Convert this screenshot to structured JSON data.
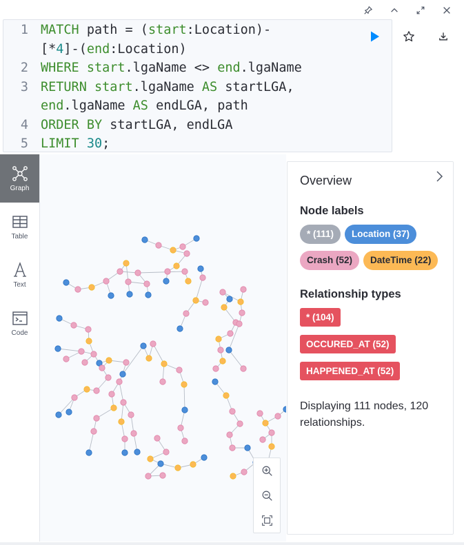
{
  "editor": {
    "line_numbers": [
      "1",
      "",
      "2",
      "3",
      "",
      "4",
      "5"
    ],
    "lines": [
      [
        {
          "t": "kw",
          "v": "MATCH"
        },
        {
          "t": "p",
          "v": " path = ("
        },
        {
          "t": "kw",
          "v": "start"
        },
        {
          "t": "p",
          "v": ":Location)-"
        }
      ],
      [
        {
          "t": "p",
          "v": "["
        },
        {
          "t": "p",
          "v": "*"
        },
        {
          "t": "num",
          "v": "4"
        },
        {
          "t": "p",
          "v": "]-("
        },
        {
          "t": "kw",
          "v": "end"
        },
        {
          "t": "p",
          "v": ":Location)"
        }
      ],
      [
        {
          "t": "kw",
          "v": "WHERE"
        },
        {
          "t": "p",
          "v": " "
        },
        {
          "t": "kw",
          "v": "start"
        },
        {
          "t": "p",
          "v": ".lgaName <> "
        },
        {
          "t": "kw",
          "v": "end"
        },
        {
          "t": "p",
          "v": ".lgaName"
        }
      ],
      [
        {
          "t": "kw",
          "v": "RETURN"
        },
        {
          "t": "p",
          "v": " "
        },
        {
          "t": "kw",
          "v": "start"
        },
        {
          "t": "p",
          "v": ".lgaName "
        },
        {
          "t": "kw",
          "v": "AS"
        },
        {
          "t": "p",
          "v": " startLGA,"
        }
      ],
      [
        {
          "t": "kw",
          "v": "end"
        },
        {
          "t": "p",
          "v": ".lgaName "
        },
        {
          "t": "kw",
          "v": "AS"
        },
        {
          "t": "p",
          "v": " endLGA, path"
        }
      ],
      [
        {
          "t": "kw",
          "v": "ORDER BY"
        },
        {
          "t": "p",
          "v": " startLGA, endLGA"
        }
      ],
      [
        {
          "t": "kw",
          "v": "LIMIT"
        },
        {
          "t": "p",
          "v": " "
        },
        {
          "t": "num",
          "v": "30"
        },
        {
          "t": "p",
          "v": ";"
        }
      ]
    ]
  },
  "view_tabs": [
    {
      "label": "Graph",
      "icon": "graph-icon",
      "active": true
    },
    {
      "label": "Table",
      "icon": "table-icon",
      "active": false
    },
    {
      "label": "Text",
      "icon": "text-icon",
      "active": false
    },
    {
      "label": "Code",
      "icon": "code-icon",
      "active": false
    }
  ],
  "overview": {
    "title": "Overview",
    "node_labels_heading": "Node labels",
    "node_labels": [
      {
        "label": "* (111)",
        "bg": "#a5abb6",
        "fg": "#ffffff"
      },
      {
        "label": "Location (37)",
        "bg": "#4c8eda",
        "fg": "#ffffff"
      },
      {
        "label": "Crash (52)",
        "bg": "#eba7c2",
        "fg": "#2a2c34"
      },
      {
        "label": "DateTime (22)",
        "bg": "#fcb955",
        "fg": "#2a2c34"
      }
    ],
    "rel_types_heading": "Relationship types",
    "rel_types": [
      {
        "label": "* (104)"
      },
      {
        "label": "OCCURED_AT (52)"
      },
      {
        "label": "HAPPENED_AT (52)"
      }
    ],
    "summary": "Displaying 111 nodes, 120 relationships."
  },
  "colors": {
    "location": "#4c8eda",
    "crash": "#eba7c2",
    "datetime": "#fcb955",
    "accent": "#018bff"
  }
}
